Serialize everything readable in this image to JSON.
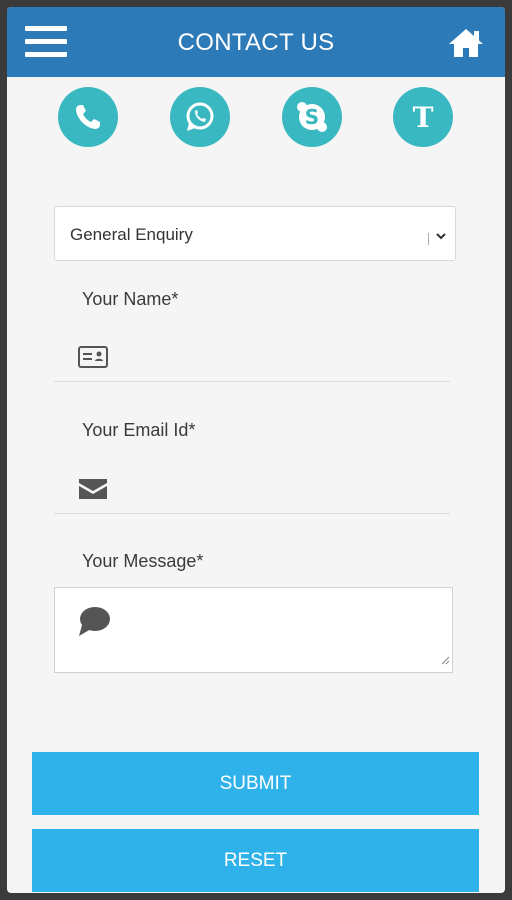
{
  "header": {
    "title": "CONTACT US",
    "menu_icon": "hamburger-menu-icon",
    "home_icon": "home-icon"
  },
  "contact_icons": [
    {
      "name": "phone-icon"
    },
    {
      "name": "whatsapp-icon"
    },
    {
      "name": "skype-icon"
    },
    {
      "name": "t-icon",
      "glyph": "T"
    }
  ],
  "form": {
    "enquiry_type": {
      "selected": "General Enquiry"
    },
    "name": {
      "label": "Your Name*",
      "value": "",
      "icon": "id-card-icon"
    },
    "email": {
      "label": "Your Email Id*",
      "value": "",
      "icon": "envelope-icon"
    },
    "message": {
      "label": "Your Message*",
      "value": "",
      "icon": "speech-bubble-icon"
    }
  },
  "buttons": {
    "submit": "SUBMIT",
    "reset": "RESET"
  },
  "colors": {
    "header": "#2d7ab9",
    "icon_circle": "#3ab8c1",
    "button": "#2fb2ea",
    "background": "#f5f5f5"
  }
}
